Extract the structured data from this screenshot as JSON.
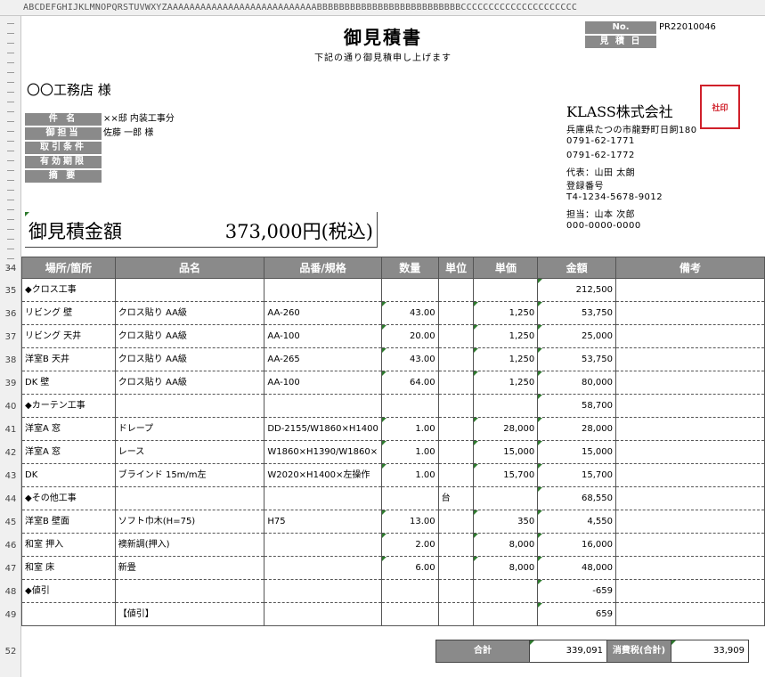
{
  "column_header": "ABCDEFGHIJKLMNOPQRSTUVWXYZAAAAAAAAAAAAAAAAAAAAAAAAAAABBBBBBBBBBBBBBBBBBBBBBBBBBCCCCCCCCCCCCCCCCCCCCC",
  "row_numbers": [
    "34",
    "35",
    "36",
    "37",
    "38",
    "39",
    "40",
    "41",
    "42",
    "43",
    "44",
    "45",
    "46",
    "47",
    "48",
    "49",
    "52"
  ],
  "title": "御見積書",
  "subtitle": "下記の通り御見積申し上げます",
  "no_label": "No.",
  "no_value": "PR22010046",
  "date_label": "見 積 日",
  "customer": "〇〇工務店 様",
  "info": [
    {
      "label": "件 名",
      "value": "××邸 内装工事分"
    },
    {
      "label": "御担当",
      "value": "佐藤 一郎 様"
    },
    {
      "label": "取引条件",
      "value": ""
    },
    {
      "label": "有効期限",
      "value": ""
    },
    {
      "label": "摘 要",
      "value": ""
    }
  ],
  "company": {
    "name": "KLASS株式会社",
    "address": "兵庫県たつの市龍野町日飼180",
    "tel": "0791-62-1771",
    "fax": "0791-62-1772",
    "rep": "代表：山田 太朗",
    "reg_label": "登録番号",
    "reg_no": "T4-1234-5678-9012",
    "contact": "担当：山本 次郎",
    "contact_tel": "000-0000-0000",
    "stamp": "社印"
  },
  "amount": {
    "label": "御見積金額",
    "value": "373,000円(税込)"
  },
  "table": {
    "headers": [
      "場所/箇所",
      "品名",
      "品番/規格",
      "数量",
      "単位",
      "単価",
      "金額",
      "備考"
    ],
    "rows": [
      [
        "◆クロス工事",
        "",
        "",
        "",
        "",
        "",
        "212,500",
        ""
      ],
      [
        "リビング 壁",
        "クロス貼り AA級",
        "AA-260",
        "43.00",
        "",
        "1,250",
        "53,750",
        ""
      ],
      [
        "リビング 天井",
        "クロス貼り AA級",
        "AA-100",
        "20.00",
        "",
        "1,250",
        "25,000",
        ""
      ],
      [
        "洋室B 天井",
        "クロス貼り AA級",
        "AA-265",
        "43.00",
        "",
        "1,250",
        "53,750",
        ""
      ],
      [
        "DK 壁",
        "クロス貼り AA級",
        "AA-100",
        "64.00",
        "",
        "1,250",
        "80,000",
        ""
      ],
      [
        "◆カーテン工事",
        "",
        "",
        "",
        "",
        "",
        "58,700",
        ""
      ],
      [
        "洋室A 窓",
        "ドレープ",
        "DD-2155/W1860×H1400",
        "1.00",
        "",
        "28,000",
        "28,000",
        ""
      ],
      [
        "洋室A 窓",
        "レース",
        "W1860×H1390/W1860×",
        "1.00",
        "",
        "15,000",
        "15,000",
        ""
      ],
      [
        "DK",
        "ブラインド 15m/m左",
        "W2020×H1400×左操作",
        "1.00",
        "",
        "15,700",
        "15,700",
        ""
      ],
      [
        "◆その他工事",
        "",
        "",
        "",
        "台",
        "",
        "68,550",
        ""
      ],
      [
        "洋室B 壁面",
        "ソフト巾木(H=75)",
        "H75",
        "13.00",
        "",
        "350",
        "4,550",
        ""
      ],
      [
        "和室 押入",
        "襖新調(押入)",
        "",
        "2.00",
        "",
        "8,000",
        "16,000",
        ""
      ],
      [
        "和室 床",
        "新畳",
        "",
        "6.00",
        "",
        "8,000",
        "48,000",
        ""
      ],
      [
        "◆値引",
        "",
        "",
        "",
        "",
        "",
        "-659",
        ""
      ],
      [
        "",
        "【値引】",
        "",
        "",
        "",
        "",
        "659",
        ""
      ]
    ]
  },
  "totals": {
    "subtotal_label": "合計",
    "subtotal_value": "339,091",
    "tax_label": "消費税(合計)",
    "tax_value": "33,909"
  },
  "colors": {
    "header_gray": "#8a8a8a",
    "stamp_red": "#d0202a",
    "comment_green": "#2d7a2d"
  }
}
